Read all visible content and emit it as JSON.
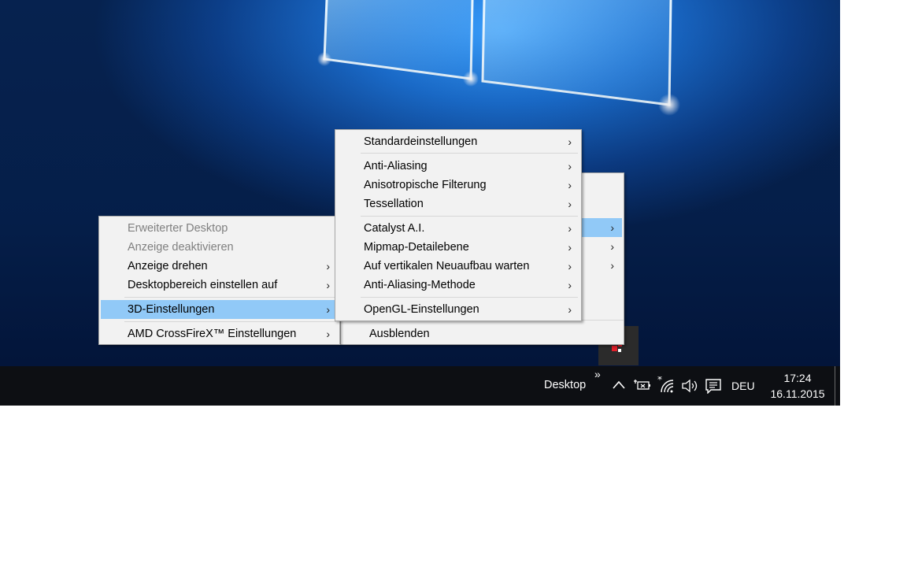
{
  "taskbar": {
    "toolbar_label": "Desktop",
    "toolbar_overflow": "»",
    "language": "DEU",
    "time": "17:24",
    "date": "16.11.2015",
    "icons": [
      "chevron-up-icon",
      "battery-plug-icon",
      "wifi-icon",
      "volume-icon",
      "action-center-icon"
    ]
  },
  "menu_main": {
    "items": [
      {
        "label": "Erweiterter Desktop",
        "disabled": true
      },
      {
        "label": "Anzeige deaktivieren",
        "disabled": true
      },
      {
        "label": "Anzeige drehen",
        "arrow": "›"
      },
      {
        "label": "Desktopbereich einstellen auf",
        "arrow": "›"
      },
      {
        "label": "3D-Einstellungen",
        "arrow": "›",
        "highlighted": true
      },
      {
        "label": "AMD CrossFireX™ Einstellungen",
        "arrow": "›"
      }
    ]
  },
  "menu_3d": {
    "items": [
      {
        "label": "Standardeinstellungen",
        "arrow": "›"
      },
      {
        "label": "Anti-Aliasing",
        "arrow": "›"
      },
      {
        "label": "Anisotropische Filterung",
        "arrow": "›"
      },
      {
        "label": "Tessellation",
        "arrow": "›"
      },
      {
        "label": "Catalyst A.I.",
        "arrow": "›"
      },
      {
        "label": "Mipmap-Detailebene",
        "arrow": "›"
      },
      {
        "label": "Auf vertikalen Neuaufbau warten",
        "arrow": "›"
      },
      {
        "label": "Anti-Aliasing-Methode",
        "arrow": "›"
      },
      {
        "label": "OpenGL-Einstellungen",
        "arrow": "›"
      }
    ]
  },
  "menu_back": {
    "items": [
      {
        "arrow": "›",
        "highlighted": true
      },
      {
        "arrow": "›"
      },
      {
        "arrow": "›"
      },
      {
        "label": "Ausblenden"
      }
    ]
  },
  "colors": {
    "menu_bg": "#f2f2f2",
    "highlight": "#91c9f7",
    "taskbar": "#0d0f13"
  }
}
